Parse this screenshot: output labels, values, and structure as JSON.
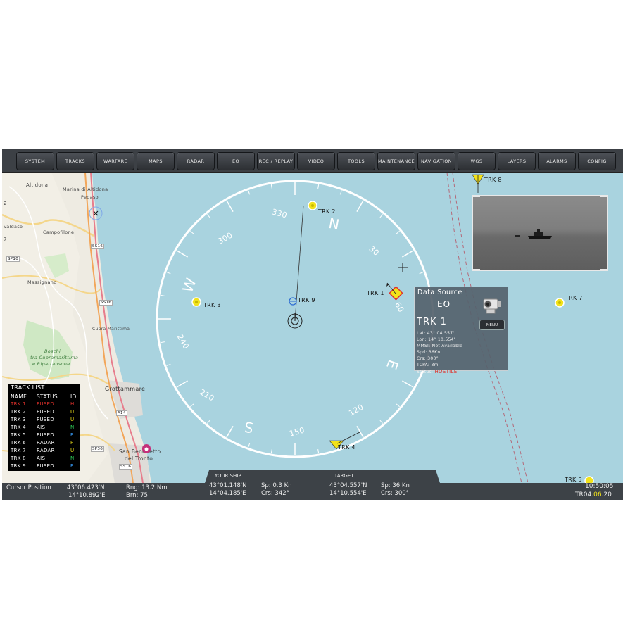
{
  "menu": [
    "SYSTEM",
    "TRACKS",
    "WARFARE",
    "MAPS",
    "RADAR",
    "EO",
    "REC / REPLAY",
    "VIDEO",
    "TOOLS",
    "MAINTENANCE",
    "NAVIGATION",
    "WGS",
    "LAYERS",
    "ALARMS",
    "CONFIG"
  ],
  "map": {
    "places": [
      "Altidona",
      "Marina di Altidona",
      "Pedaso",
      "Valdaso",
      "Campofilone",
      "Massignano",
      "Cupra Marittima",
      "Boschi",
      "tra Cupramarittima",
      "e Ripatransone",
      "Grottammare",
      "San Benedetto",
      "del Tronto"
    ],
    "roads": [
      "SS16",
      "SP10",
      "SS16",
      "A14",
      "SP36",
      "SS16"
    ],
    "edge_numbers": [
      "2",
      "7"
    ]
  },
  "compass": {
    "bearings": [
      "330",
      "30",
      "60",
      "120",
      "150",
      "210",
      "240",
      "300"
    ],
    "cardinals": [
      "N",
      "E",
      "S",
      "W"
    ]
  },
  "tracks": [
    "TRK 1",
    "TRK 2",
    "TRK 3",
    "TRK 4",
    "TRK 5",
    "TRK 7",
    "TRK 8",
    "TRK 9"
  ],
  "data_source": {
    "title": "Data Source",
    "source": "EO",
    "track": "TRK 1",
    "menu_label": "MENU",
    "lines": [
      "Lat: 43° 04.557'",
      "Lon: 14° 10.554'",
      "MMSI: Not Available",
      "Spd: 36Kn",
      "Crs: 300°",
      "TCPA: 3m"
    ],
    "status_label": "Status:",
    "status_value": "HOSTILE",
    "status_color": "#e0312b"
  },
  "track_list": {
    "title": "TRACK LIST",
    "headers": [
      "NAME",
      "STATUS",
      "ID"
    ],
    "rows": [
      {
        "name": "TRK 1",
        "status": "FUSED",
        "id": "H",
        "color": "#e0312b",
        "id_color": "#e0312b"
      },
      {
        "name": "TRK 2",
        "status": "FUSED",
        "id": "U",
        "color": "#ffffff",
        "id_color": "#f2e21a"
      },
      {
        "name": "TRK 3",
        "status": "FUSED",
        "id": "U",
        "color": "#ffffff",
        "id_color": "#f2e21a"
      },
      {
        "name": "TRK 4",
        "status": "AIS",
        "id": "N",
        "color": "#ffffff",
        "id_color": "#2fd25a"
      },
      {
        "name": "TRK 5",
        "status": "FUSED",
        "id": "F",
        "color": "#ffffff",
        "id_color": "#3aa0ff"
      },
      {
        "name": "TRK 6",
        "status": "RADAR",
        "id": "P",
        "color": "#ffffff",
        "id_color": "#f2e21a"
      },
      {
        "name": "TRK 7",
        "status": "RADAR",
        "id": "U",
        "color": "#ffffff",
        "id_color": "#f2e21a"
      },
      {
        "name": "TRK 8",
        "status": "AIS",
        "id": "N",
        "color": "#ffffff",
        "id_color": "#2fd25a"
      },
      {
        "name": "TRK 9",
        "status": "FUSED",
        "id": "F",
        "color": "#ffffff",
        "id_color": "#3aa0ff"
      }
    ]
  },
  "bottom": {
    "cursor_label": "Cursor Position",
    "cursor_lat": "43°06.423'N",
    "cursor_lon": "14°10.892'E",
    "rng": "Rng: 13.2 Nm",
    "brn": "Brn: 75",
    "your_ship_label": "YOUR SHIP",
    "ship_lat": "43°01.148'N",
    "ship_lon": "14°04.185'E",
    "ship_sp": "Sp: 0.3 Kn",
    "ship_crs": "Crs: 342°",
    "target_label": "TARGET",
    "target_lat": "43°04.557'N",
    "target_lon": "14°10.554'E",
    "target_sp": "Sp: 36 Kn",
    "target_crs": "Crs: 300°",
    "time": "10:50:05",
    "date_prefix": "TR",
    "date_a": "04.",
    "date_b": "06",
    "date_c": ".20"
  },
  "colors": {
    "sea": "#a9d3df",
    "hostile": "#e0312b",
    "unknown": "#f2e21a",
    "friend": "#3aa0ff",
    "neutral": "#2fd25a",
    "panel": "#3d4247"
  }
}
